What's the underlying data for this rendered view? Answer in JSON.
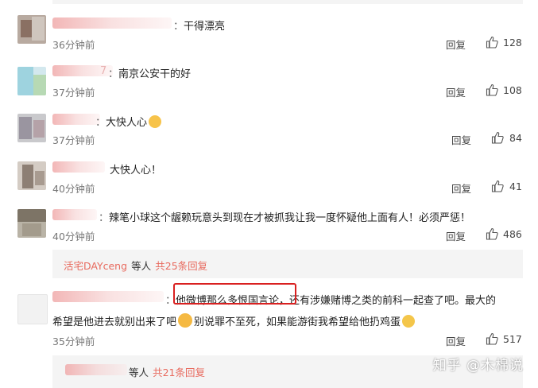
{
  "comments": [
    {
      "text": "干得漂亮",
      "time": "36分钟前",
      "reply": "回复",
      "likes": "128"
    },
    {
      "text": "南京公安干的好",
      "time": "37分钟前",
      "reply": "回复",
      "likes": "108"
    },
    {
      "text": "大快人心",
      "time": "37分钟前",
      "reply": "回复",
      "likes": "84"
    },
    {
      "text": "大快人心！",
      "time": "40分钟前",
      "reply": "回复",
      "likes": "41"
    },
    {
      "text": "辣笔小球这个龌赖玩意头到现在才被抓我让我一度怀疑他上面有人！必须严惩！",
      "time": "40分钟前",
      "reply": "回复",
      "likes": "486"
    },
    {
      "text_highlight": "他微博那么多恨国言论，",
      "text_line1_rest": "还有涉嫌赌博之类的前科一起查了吧。最大的",
      "text_line2_a": "希望是他进去就别出来了吧",
      "text_line2_b": "别说罪不至死，如果能游街我希望给他扔鸡蛋",
      "time": "35分钟前",
      "reply": "回复",
      "likes": "517"
    }
  ],
  "subreplies": [
    {
      "user": "活宅DAYceng",
      "suffix": "等人",
      "count": "共25条回复"
    },
    {
      "suffix": "等人",
      "count": "共21条回复"
    }
  ],
  "watermark": "知乎 @木棉说",
  "colors": {
    "link": "#e86a5e",
    "highlight_border": "#d92020"
  }
}
